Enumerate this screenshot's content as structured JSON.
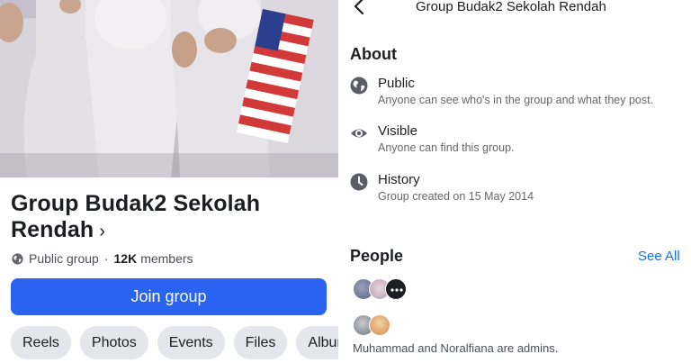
{
  "group": {
    "name": "Group Budak2 Sekolah Rendah",
    "name_line1": "Group Budak2 Sekolah",
    "name_line2": "Rendah",
    "title_chevron": "›",
    "privacy": "Public group",
    "separator": "·",
    "member_count": "12K",
    "members_label": "members",
    "join_label": "Join group",
    "tabs": [
      "Reels",
      "Photos",
      "Events",
      "Files",
      "Album"
    ]
  },
  "about_panel": {
    "header_title": "Group Budak2 Sekolah Rendah",
    "back_icon": "chevron-left-icon",
    "about_heading": "About",
    "items": [
      {
        "icon": "globe-icon",
        "title": "Public",
        "description": "Anyone can see who's in the group and what they post."
      },
      {
        "icon": "eye-icon",
        "title": "Visible",
        "description": "Anyone can find this group."
      },
      {
        "icon": "clock-icon",
        "title": "History",
        "description": "Group created on 15 May 2014"
      }
    ],
    "people_heading": "People",
    "see_all_label": "See All",
    "admins_text": "Muhammad and Noralfiana are admins."
  },
  "colors": {
    "primary_button": "#2a62f2",
    "link": "#1b6fe8",
    "chip_background": "#e4e6eb",
    "secondary_text": "#65676b"
  }
}
